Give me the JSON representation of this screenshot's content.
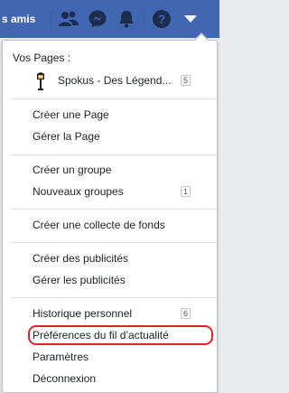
{
  "topbar": {
    "find_friends": "s amis",
    "icons": [
      "friends-icon",
      "messenger-icon",
      "notifications-icon",
      "help-icon",
      "dropdown-arrow-icon"
    ],
    "bg_color": "#4267b2"
  },
  "menu": {
    "pages_title": "Vos Pages :",
    "page_name": "Spokus - Des Légend...",
    "page_badge": "5",
    "create_page": "Créer une Page",
    "manage_page": "Gérer la Page",
    "create_group": "Créer un groupe",
    "new_groups": "Nouveaux groupes",
    "new_groups_badge": "1",
    "create_fundraiser": "Créer une collecte de fonds",
    "create_ads": "Créer des publicités",
    "manage_ads": "Gérer les publicités",
    "activity_log": "Historique personnel",
    "activity_log_badge": "6",
    "news_feed_prefs": "Préférences du fil d’actualité",
    "settings": "Paramètres",
    "logout": "Déconnexion"
  },
  "highlight_color": "#e0212c"
}
